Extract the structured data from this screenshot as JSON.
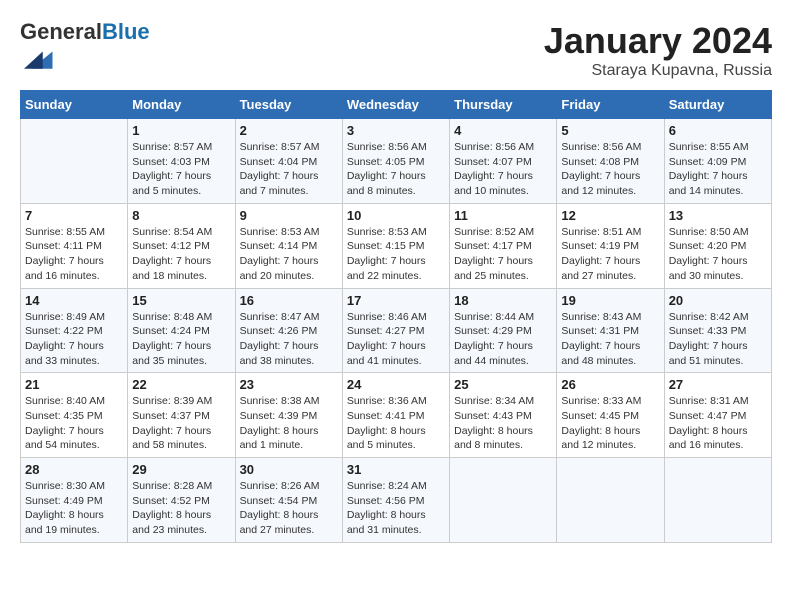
{
  "header": {
    "logo_general": "General",
    "logo_blue": "Blue",
    "month": "January 2024",
    "location": "Staraya Kupavna, Russia"
  },
  "days_of_week": [
    "Sunday",
    "Monday",
    "Tuesday",
    "Wednesday",
    "Thursday",
    "Friday",
    "Saturday"
  ],
  "weeks": [
    [
      {
        "day": "",
        "sunrise": "",
        "sunset": "",
        "daylight": ""
      },
      {
        "day": "1",
        "sunrise": "Sunrise: 8:57 AM",
        "sunset": "Sunset: 4:03 PM",
        "daylight": "Daylight: 7 hours and 5 minutes."
      },
      {
        "day": "2",
        "sunrise": "Sunrise: 8:57 AM",
        "sunset": "Sunset: 4:04 PM",
        "daylight": "Daylight: 7 hours and 7 minutes."
      },
      {
        "day": "3",
        "sunrise": "Sunrise: 8:56 AM",
        "sunset": "Sunset: 4:05 PM",
        "daylight": "Daylight: 7 hours and 8 minutes."
      },
      {
        "day": "4",
        "sunrise": "Sunrise: 8:56 AM",
        "sunset": "Sunset: 4:07 PM",
        "daylight": "Daylight: 7 hours and 10 minutes."
      },
      {
        "day": "5",
        "sunrise": "Sunrise: 8:56 AM",
        "sunset": "Sunset: 4:08 PM",
        "daylight": "Daylight: 7 hours and 12 minutes."
      },
      {
        "day": "6",
        "sunrise": "Sunrise: 8:55 AM",
        "sunset": "Sunset: 4:09 PM",
        "daylight": "Daylight: 7 hours and 14 minutes."
      }
    ],
    [
      {
        "day": "7",
        "sunrise": "Sunrise: 8:55 AM",
        "sunset": "Sunset: 4:11 PM",
        "daylight": "Daylight: 7 hours and 16 minutes."
      },
      {
        "day": "8",
        "sunrise": "Sunrise: 8:54 AM",
        "sunset": "Sunset: 4:12 PM",
        "daylight": "Daylight: 7 hours and 18 minutes."
      },
      {
        "day": "9",
        "sunrise": "Sunrise: 8:53 AM",
        "sunset": "Sunset: 4:14 PM",
        "daylight": "Daylight: 7 hours and 20 minutes."
      },
      {
        "day": "10",
        "sunrise": "Sunrise: 8:53 AM",
        "sunset": "Sunset: 4:15 PM",
        "daylight": "Daylight: 7 hours and 22 minutes."
      },
      {
        "day": "11",
        "sunrise": "Sunrise: 8:52 AM",
        "sunset": "Sunset: 4:17 PM",
        "daylight": "Daylight: 7 hours and 25 minutes."
      },
      {
        "day": "12",
        "sunrise": "Sunrise: 8:51 AM",
        "sunset": "Sunset: 4:19 PM",
        "daylight": "Daylight: 7 hours and 27 minutes."
      },
      {
        "day": "13",
        "sunrise": "Sunrise: 8:50 AM",
        "sunset": "Sunset: 4:20 PM",
        "daylight": "Daylight: 7 hours and 30 minutes."
      }
    ],
    [
      {
        "day": "14",
        "sunrise": "Sunrise: 8:49 AM",
        "sunset": "Sunset: 4:22 PM",
        "daylight": "Daylight: 7 hours and 33 minutes."
      },
      {
        "day": "15",
        "sunrise": "Sunrise: 8:48 AM",
        "sunset": "Sunset: 4:24 PM",
        "daylight": "Daylight: 7 hours and 35 minutes."
      },
      {
        "day": "16",
        "sunrise": "Sunrise: 8:47 AM",
        "sunset": "Sunset: 4:26 PM",
        "daylight": "Daylight: 7 hours and 38 minutes."
      },
      {
        "day": "17",
        "sunrise": "Sunrise: 8:46 AM",
        "sunset": "Sunset: 4:27 PM",
        "daylight": "Daylight: 7 hours and 41 minutes."
      },
      {
        "day": "18",
        "sunrise": "Sunrise: 8:44 AM",
        "sunset": "Sunset: 4:29 PM",
        "daylight": "Daylight: 7 hours and 44 minutes."
      },
      {
        "day": "19",
        "sunrise": "Sunrise: 8:43 AM",
        "sunset": "Sunset: 4:31 PM",
        "daylight": "Daylight: 7 hours and 48 minutes."
      },
      {
        "day": "20",
        "sunrise": "Sunrise: 8:42 AM",
        "sunset": "Sunset: 4:33 PM",
        "daylight": "Daylight: 7 hours and 51 minutes."
      }
    ],
    [
      {
        "day": "21",
        "sunrise": "Sunrise: 8:40 AM",
        "sunset": "Sunset: 4:35 PM",
        "daylight": "Daylight: 7 hours and 54 minutes."
      },
      {
        "day": "22",
        "sunrise": "Sunrise: 8:39 AM",
        "sunset": "Sunset: 4:37 PM",
        "daylight": "Daylight: 7 hours and 58 minutes."
      },
      {
        "day": "23",
        "sunrise": "Sunrise: 8:38 AM",
        "sunset": "Sunset: 4:39 PM",
        "daylight": "Daylight: 8 hours and 1 minute."
      },
      {
        "day": "24",
        "sunrise": "Sunrise: 8:36 AM",
        "sunset": "Sunset: 4:41 PM",
        "daylight": "Daylight: 8 hours and 5 minutes."
      },
      {
        "day": "25",
        "sunrise": "Sunrise: 8:34 AM",
        "sunset": "Sunset: 4:43 PM",
        "daylight": "Daylight: 8 hours and 8 minutes."
      },
      {
        "day": "26",
        "sunrise": "Sunrise: 8:33 AM",
        "sunset": "Sunset: 4:45 PM",
        "daylight": "Daylight: 8 hours and 12 minutes."
      },
      {
        "day": "27",
        "sunrise": "Sunrise: 8:31 AM",
        "sunset": "Sunset: 4:47 PM",
        "daylight": "Daylight: 8 hours and 16 minutes."
      }
    ],
    [
      {
        "day": "28",
        "sunrise": "Sunrise: 8:30 AM",
        "sunset": "Sunset: 4:49 PM",
        "daylight": "Daylight: 8 hours and 19 minutes."
      },
      {
        "day": "29",
        "sunrise": "Sunrise: 8:28 AM",
        "sunset": "Sunset: 4:52 PM",
        "daylight": "Daylight: 8 hours and 23 minutes."
      },
      {
        "day": "30",
        "sunrise": "Sunrise: 8:26 AM",
        "sunset": "Sunset: 4:54 PM",
        "daylight": "Daylight: 8 hours and 27 minutes."
      },
      {
        "day": "31",
        "sunrise": "Sunrise: 8:24 AM",
        "sunset": "Sunset: 4:56 PM",
        "daylight": "Daylight: 8 hours and 31 minutes."
      },
      {
        "day": "",
        "sunrise": "",
        "sunset": "",
        "daylight": ""
      },
      {
        "day": "",
        "sunrise": "",
        "sunset": "",
        "daylight": ""
      },
      {
        "day": "",
        "sunrise": "",
        "sunset": "",
        "daylight": ""
      }
    ]
  ]
}
